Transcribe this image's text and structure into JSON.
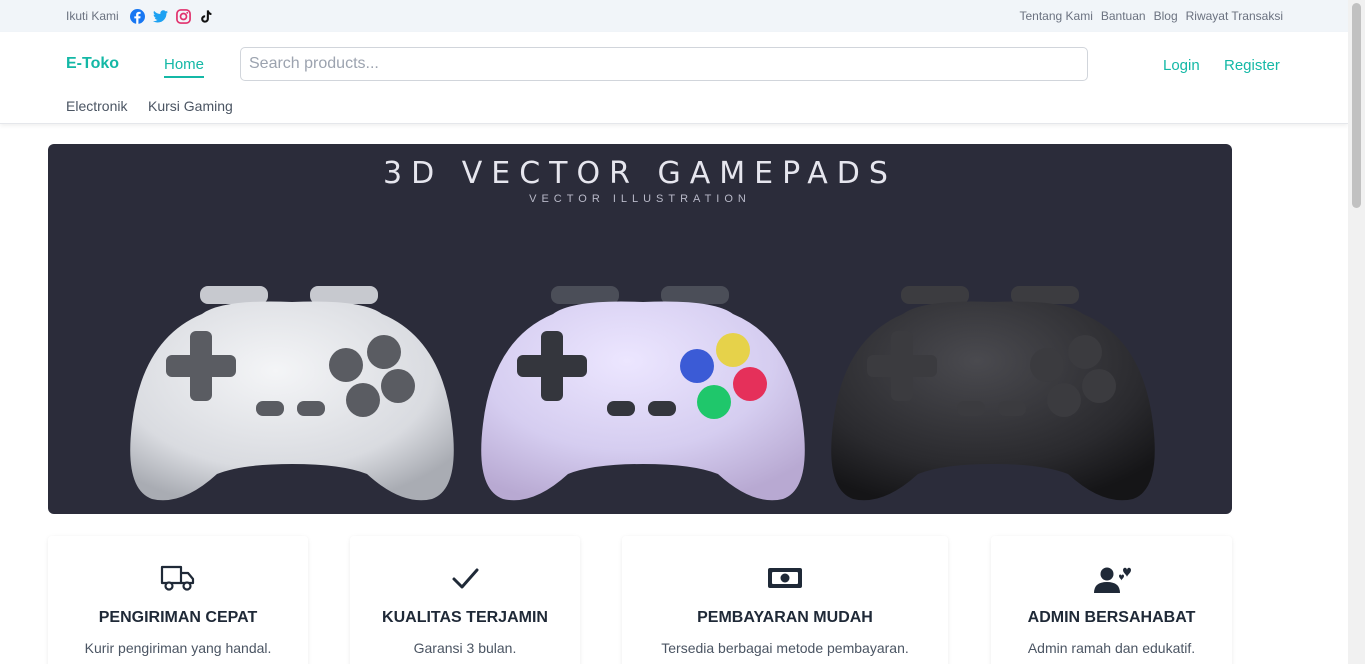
{
  "topbar": {
    "follow_label": "Ikuti Kami",
    "social": [
      {
        "icon": "facebook-icon",
        "color": "#1877f2"
      },
      {
        "icon": "twitter-icon",
        "color": "#1da1f2"
      },
      {
        "icon": "instagram-icon",
        "color": "#e1306c"
      },
      {
        "icon": "tiktok-icon",
        "color": "#111111"
      }
    ],
    "links": [
      "Tentang Kami",
      "Bantuan",
      "Blog",
      "Riwayat Transaksi"
    ]
  },
  "navbar": {
    "brand": "E-Toko",
    "home": "Home",
    "search_placeholder": "Search products...",
    "login": "Login",
    "register": "Register",
    "categories": [
      "Electronik",
      "Kursi Gaming"
    ]
  },
  "hero": {
    "title": "3D VECTOR GAMEPADS",
    "subtitle": "VECTOR ILLUSTRATION"
  },
  "features": [
    {
      "icon": "truck-icon",
      "title": "PENGIRIMAN CEPAT",
      "desc": "Kurir pengiriman yang handal."
    },
    {
      "icon": "check-icon",
      "title": "KUALITAS TERJAMIN",
      "desc": "Garansi 3 bulan."
    },
    {
      "icon": "money-bill-icon",
      "title": "PEMBAYARAN MUDAH",
      "desc": "Tersedia berbagai metode pembayaran."
    },
    {
      "icon": "user-heart-icon",
      "title": "ADMIN BERSAHABAT",
      "desc": "Admin ramah dan edukatif."
    }
  ],
  "colors": {
    "accent": "#14b8a6",
    "hero_bg": "#2b2c3a"
  }
}
